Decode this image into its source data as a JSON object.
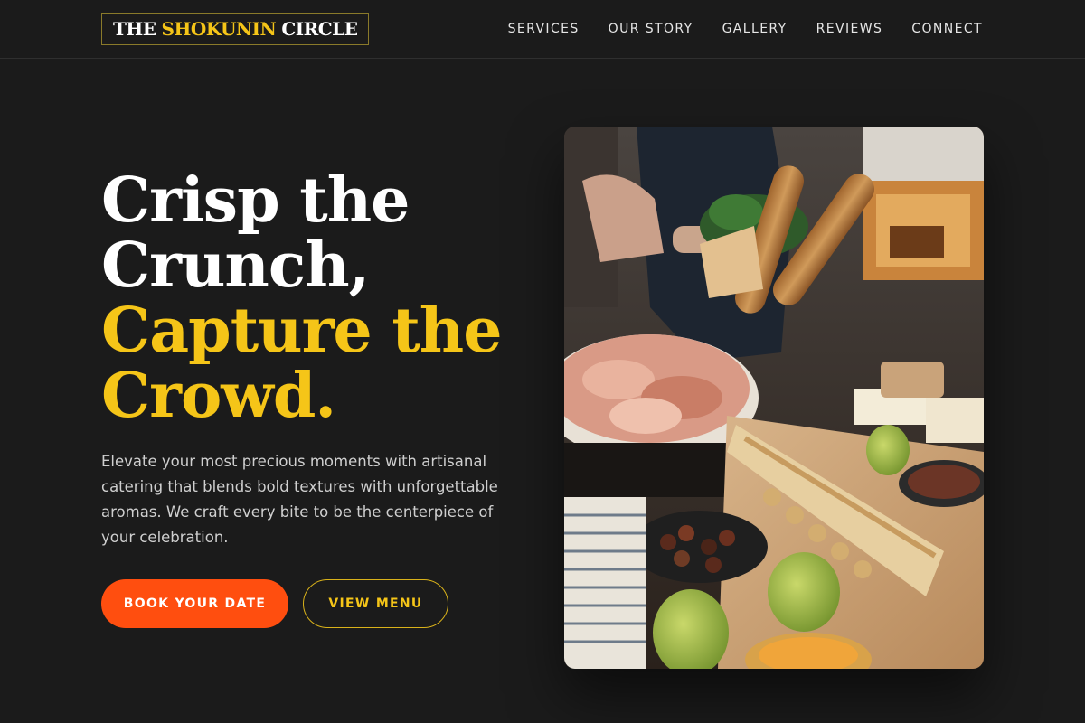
{
  "brand": {
    "logo_word_1": "THE",
    "logo_word_2": "SHOKUNIN",
    "logo_word_3": "CIRCLE"
  },
  "nav": {
    "items": [
      {
        "label": "SERVICES"
      },
      {
        "label": "OUR STORY"
      },
      {
        "label": "GALLERY"
      },
      {
        "label": "REVIEWS"
      },
      {
        "label": "CONNECT"
      }
    ]
  },
  "hero": {
    "headline_line_1": "Crisp the",
    "headline_line_2": "Crunch,",
    "headline_line_3": "Capture the",
    "headline_line_4": "Crowd.",
    "description": "Elevate your most precious moments with artisanal catering that blends bold textures with unforgettable aromas. We craft every bite to be the centerpiece of your celebration.",
    "primary_cta": "BOOK YOUR DATE",
    "secondary_cta": "VIEW MENU"
  },
  "colors": {
    "background": "#1b1b1b",
    "accent_gold": "#f5c518",
    "accent_orange": "#ff4e0f",
    "text_muted": "#cfcfcf"
  },
  "image": {
    "subject": "catering-buffet-table-photo"
  }
}
